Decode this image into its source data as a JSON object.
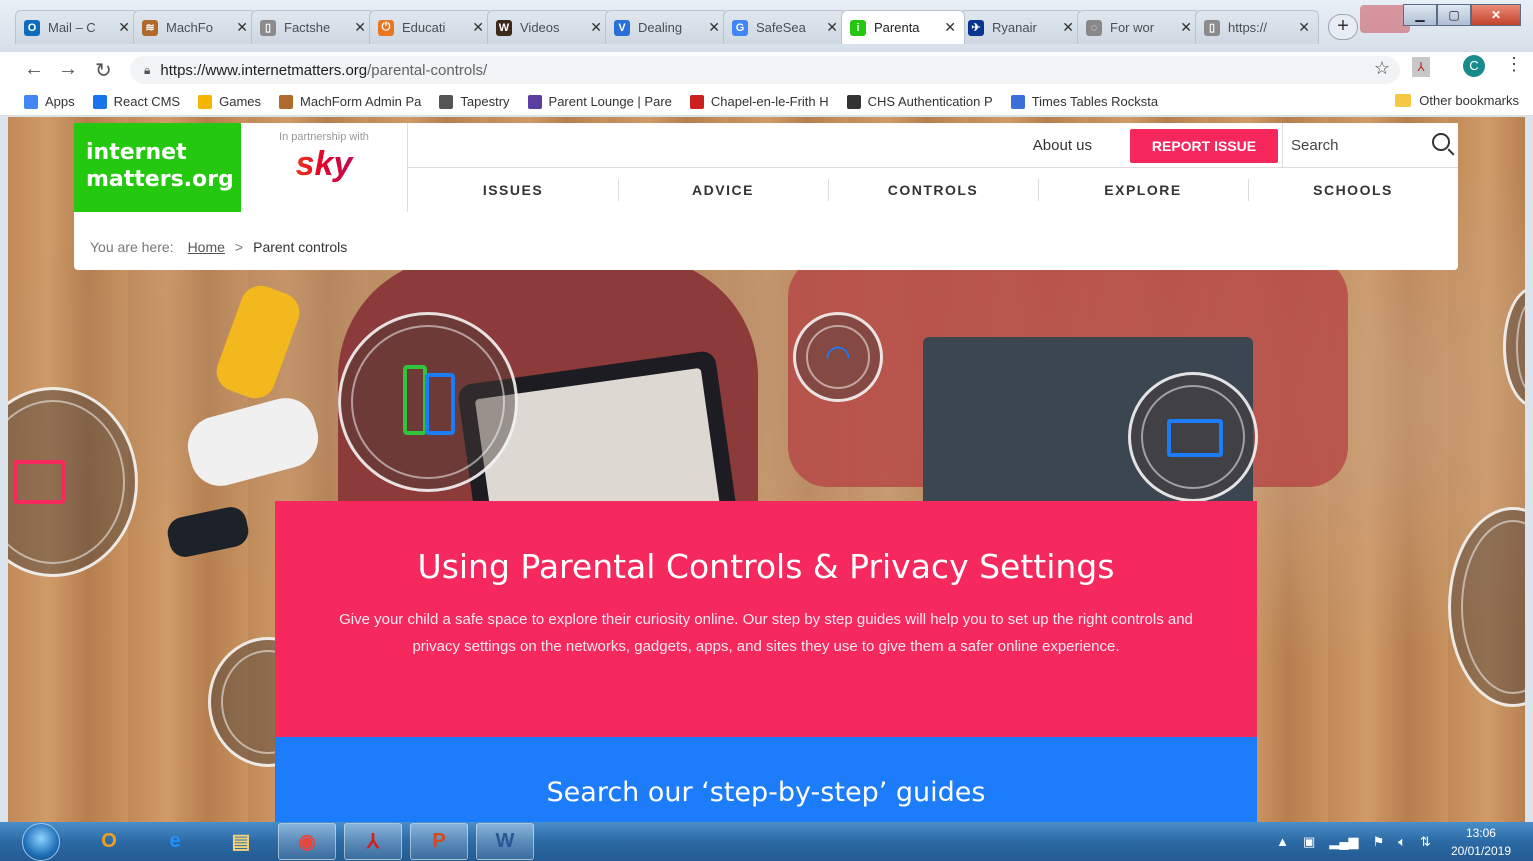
{
  "browser": {
    "tabs": [
      {
        "label": "Mail – C",
        "icon_color": "#0f6cbd",
        "icon_text": "O"
      },
      {
        "label": "MachFo",
        "icon_color": "#b06a2c",
        "icon_text": "≋"
      },
      {
        "label": "Factshe",
        "icon_color": "#8a8a8a",
        "icon_text": "▯"
      },
      {
        "label": "Educati",
        "icon_color": "#e87722",
        "icon_text": "⏻"
      },
      {
        "label": "Videos",
        "icon_color": "#3b2a1a",
        "icon_text": "W"
      },
      {
        "label": "Dealing",
        "icon_color": "#2a6fd6",
        "icon_text": "V"
      },
      {
        "label": "SafeSea",
        "icon_color": "#4285f4",
        "icon_text": "G"
      },
      {
        "label": "Parenta",
        "icon_color": "#24c80f",
        "icon_text": "i",
        "active": true
      },
      {
        "label": "Ryanair",
        "icon_color": "#073590",
        "icon_text": "✈"
      },
      {
        "label": "For wor",
        "icon_color": "#888888",
        "icon_text": "◌"
      },
      {
        "label": "https://",
        "icon_color": "#8a8a8a",
        "icon_text": "▯"
      }
    ],
    "new_tab": "+",
    "url_domain": "https://www.internetmatters.org",
    "url_path": "/parental-controls/",
    "profile_initial": "C",
    "bookmarks": [
      {
        "label": "Apps",
        "color": "#4285f4"
      },
      {
        "label": "React CMS",
        "color": "#1a73e8"
      },
      {
        "label": "Games",
        "color": "#f4b400"
      },
      {
        "label": "MachForm Admin Pa",
        "color": "#b06a2c"
      },
      {
        "label": "Tapestry",
        "color": "#555555"
      },
      {
        "label": "Parent Lounge | Pare",
        "color": "#5a3ea0"
      },
      {
        "label": "Chapel-en-le-Frith H",
        "color": "#cc1f1f"
      },
      {
        "label": "CHS Authentication P",
        "color": "#333333"
      },
      {
        "label": "Times Tables Rocksta",
        "color": "#3a6ed8"
      }
    ],
    "other_bookmarks": "Other bookmarks"
  },
  "site": {
    "logo_line1": "internet",
    "logo_line2": "matters.org",
    "partner_text": "In partnership with",
    "partner_brand": "sky",
    "about": "About us",
    "report": "REPORT ISSUE",
    "search_placeholder": "Search",
    "nav": [
      "ISSUES",
      "ADVICE",
      "CONTROLS",
      "EXPLORE",
      "SCHOOLS"
    ],
    "breadcrumb_label": "You are here:",
    "breadcrumb_home": "Home",
    "breadcrumb_sep": ">",
    "breadcrumb_current": "Parent controls",
    "hero_title": "Using Parental Controls & Privacy Settings",
    "hero_text": "Give your child a safe space to explore their curiosity online. Our step by step guides will help you to set up the right controls and privacy settings on the networks, gadgets, apps, and sites they use to give them a safer online experience.",
    "guides_title": "Search our ‘step-by-step’ guides"
  },
  "taskbar": {
    "apps": [
      {
        "name": "outlook",
        "label": "O",
        "color": "#f0a020"
      },
      {
        "name": "ie",
        "label": "e",
        "color": "#1e90ff"
      },
      {
        "name": "explorer",
        "label": "▤",
        "color": "#f3d27a"
      },
      {
        "name": "chrome",
        "label": "◉",
        "color": "#e8453c"
      },
      {
        "name": "acrobat",
        "label": "⅄",
        "color": "#d71f1f"
      },
      {
        "name": "powerpoint",
        "label": "P",
        "color": "#d2491f"
      },
      {
        "name": "word",
        "label": "W",
        "color": "#2b5797"
      }
    ],
    "time": "13:06",
    "date": "20/01/2019"
  }
}
